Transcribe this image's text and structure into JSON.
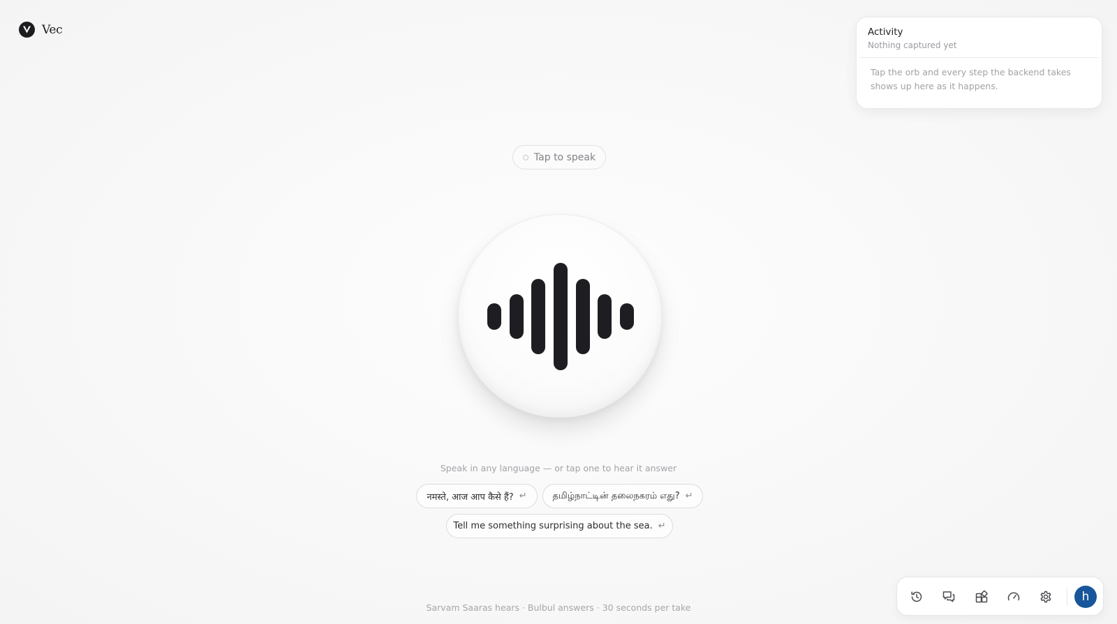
{
  "brand": {
    "name": "Vec",
    "logo_icon": "v-logo-icon"
  },
  "activity": {
    "title": "Activity",
    "subtitle": "Nothing captured yet",
    "body": "Tap the orb and every step the backend takes shows up here as it happens."
  },
  "status": {
    "label": "Tap to speak"
  },
  "orb": {
    "icon": "waveform-icon"
  },
  "suggestions": {
    "hint": "Speak in any language — or tap one to hear it answer",
    "chips": [
      {
        "label": "नमस्ते, आज आप कैसे हैं?",
        "icon": "return-icon"
      },
      {
        "label": "தமிழ்நாட்டின் தலைநகரம் எது?",
        "icon": "return-icon"
      },
      {
        "label": "Tell me something surprising about the sea.",
        "icon": "return-icon"
      }
    ],
    "return_glyph": "↵"
  },
  "footer": {
    "text": "Sarvam Saaras hears · Bulbul answers · 30 seconds per take"
  },
  "dock": {
    "buttons": [
      {
        "icon": "history-icon"
      },
      {
        "icon": "chat-icon"
      },
      {
        "icon": "widgets-icon"
      },
      {
        "icon": "gauge-icon"
      },
      {
        "icon": "gear-icon"
      }
    ],
    "avatar_initial": "h",
    "avatar_color": "#17569a"
  },
  "colors": {
    "background": "#f8f8f8",
    "orb_bars": "#1e1e22",
    "accent": "#17569a"
  }
}
